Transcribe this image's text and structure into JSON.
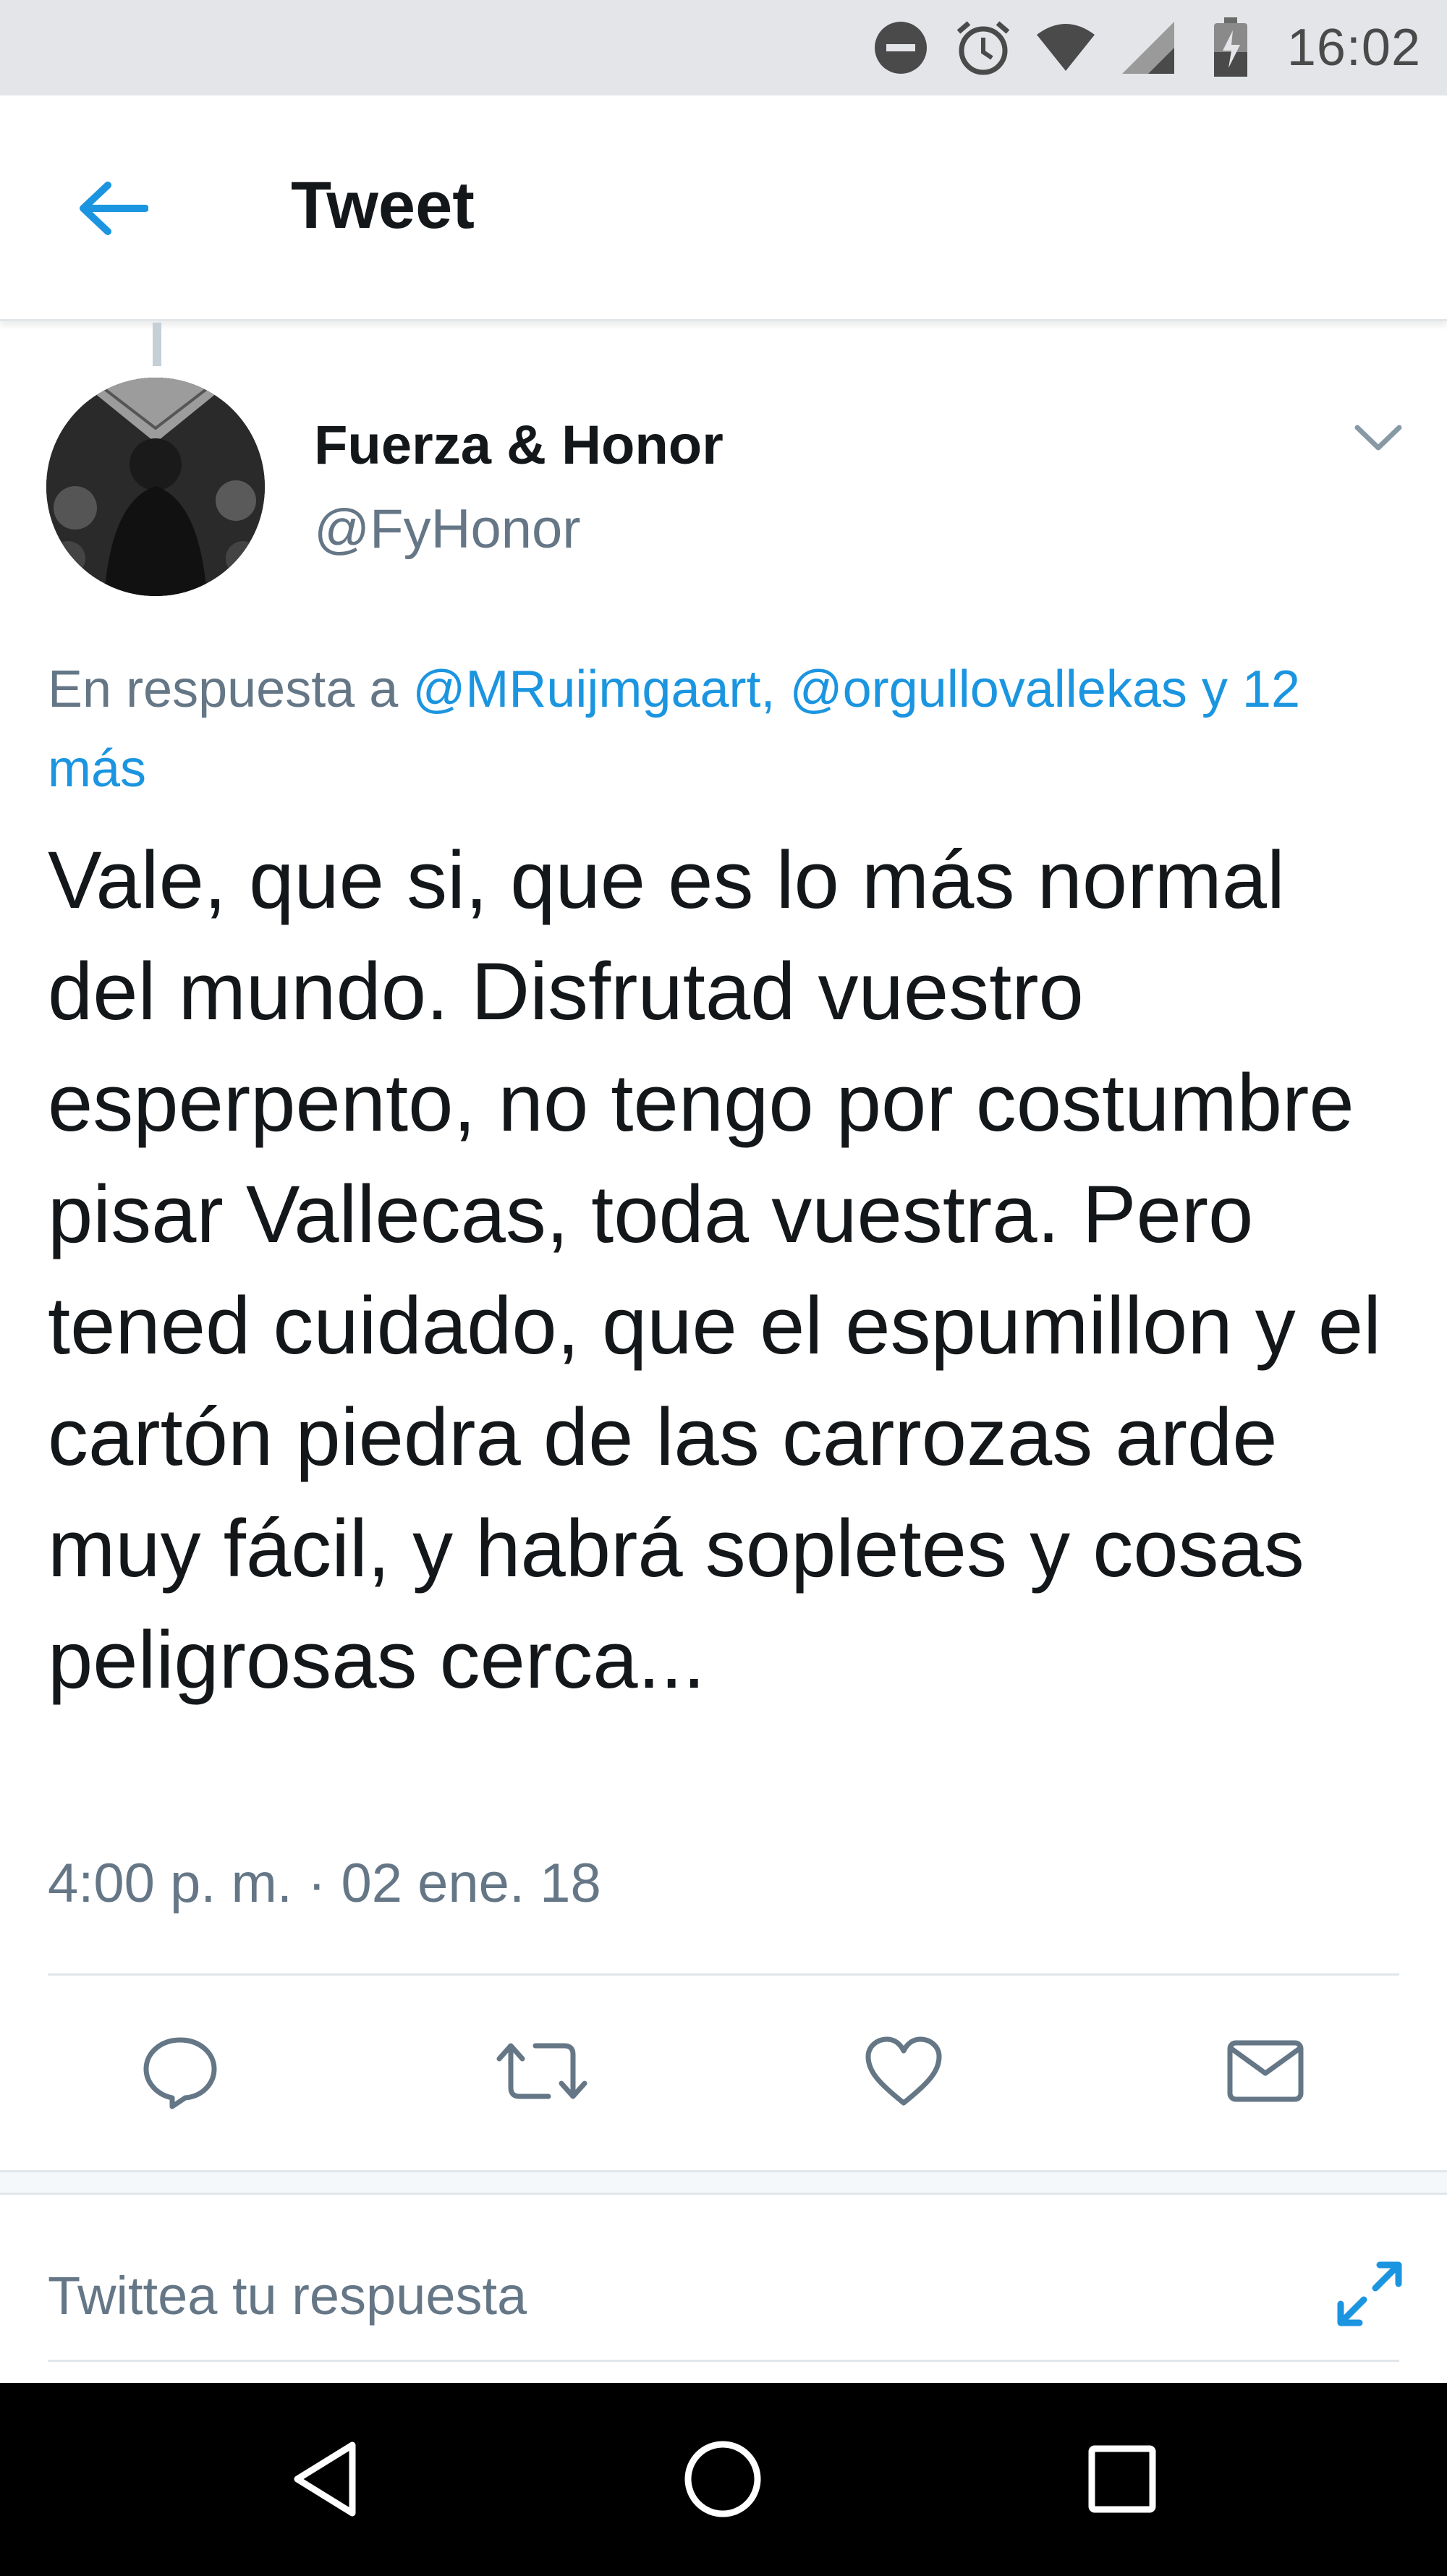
{
  "status_bar": {
    "time": "16:02",
    "icons": [
      "do-not-disturb-icon",
      "alarm-icon",
      "wifi-icon",
      "cell-signal-icon",
      "battery-icon"
    ]
  },
  "header": {
    "title": "Tweet",
    "back_icon": "arrow-left-icon"
  },
  "tweet": {
    "author_name": "Fuerza & Honor",
    "author_handle": "@FyHonor",
    "reply_prefix": "En respuesta a ",
    "reply_mention_1": "@MRuijmgaart,",
    "reply_mention_2": "@orgullovallekas",
    "reply_more": "y 12 más",
    "text": "Vale, que si, que es lo más normal del mundo. Disfrutad vuestro esperpento, no tengo por costumbre pisar Vallecas, toda vuestra. Pero tened cuidado, que el espumillon y el cartón piedra de las carrozas arde muy fácil, y habrá sopletes y cosas peligrosas cerca...",
    "timestamp": "4:00 p. m. · 02 ene. 18"
  },
  "actions": [
    "reply-icon",
    "retweet-icon",
    "like-icon",
    "direct-message-icon"
  ],
  "reply_box": {
    "placeholder": "Twittea tu respuesta"
  },
  "nav_bar": [
    "back-triangle-icon",
    "home-circle-icon",
    "recents-square-icon"
  ],
  "colors": {
    "accent": "#1b95e0",
    "secondary_text": "#657786",
    "primary_text": "#14171a",
    "status_bar_bg": "#e3e5e8"
  }
}
